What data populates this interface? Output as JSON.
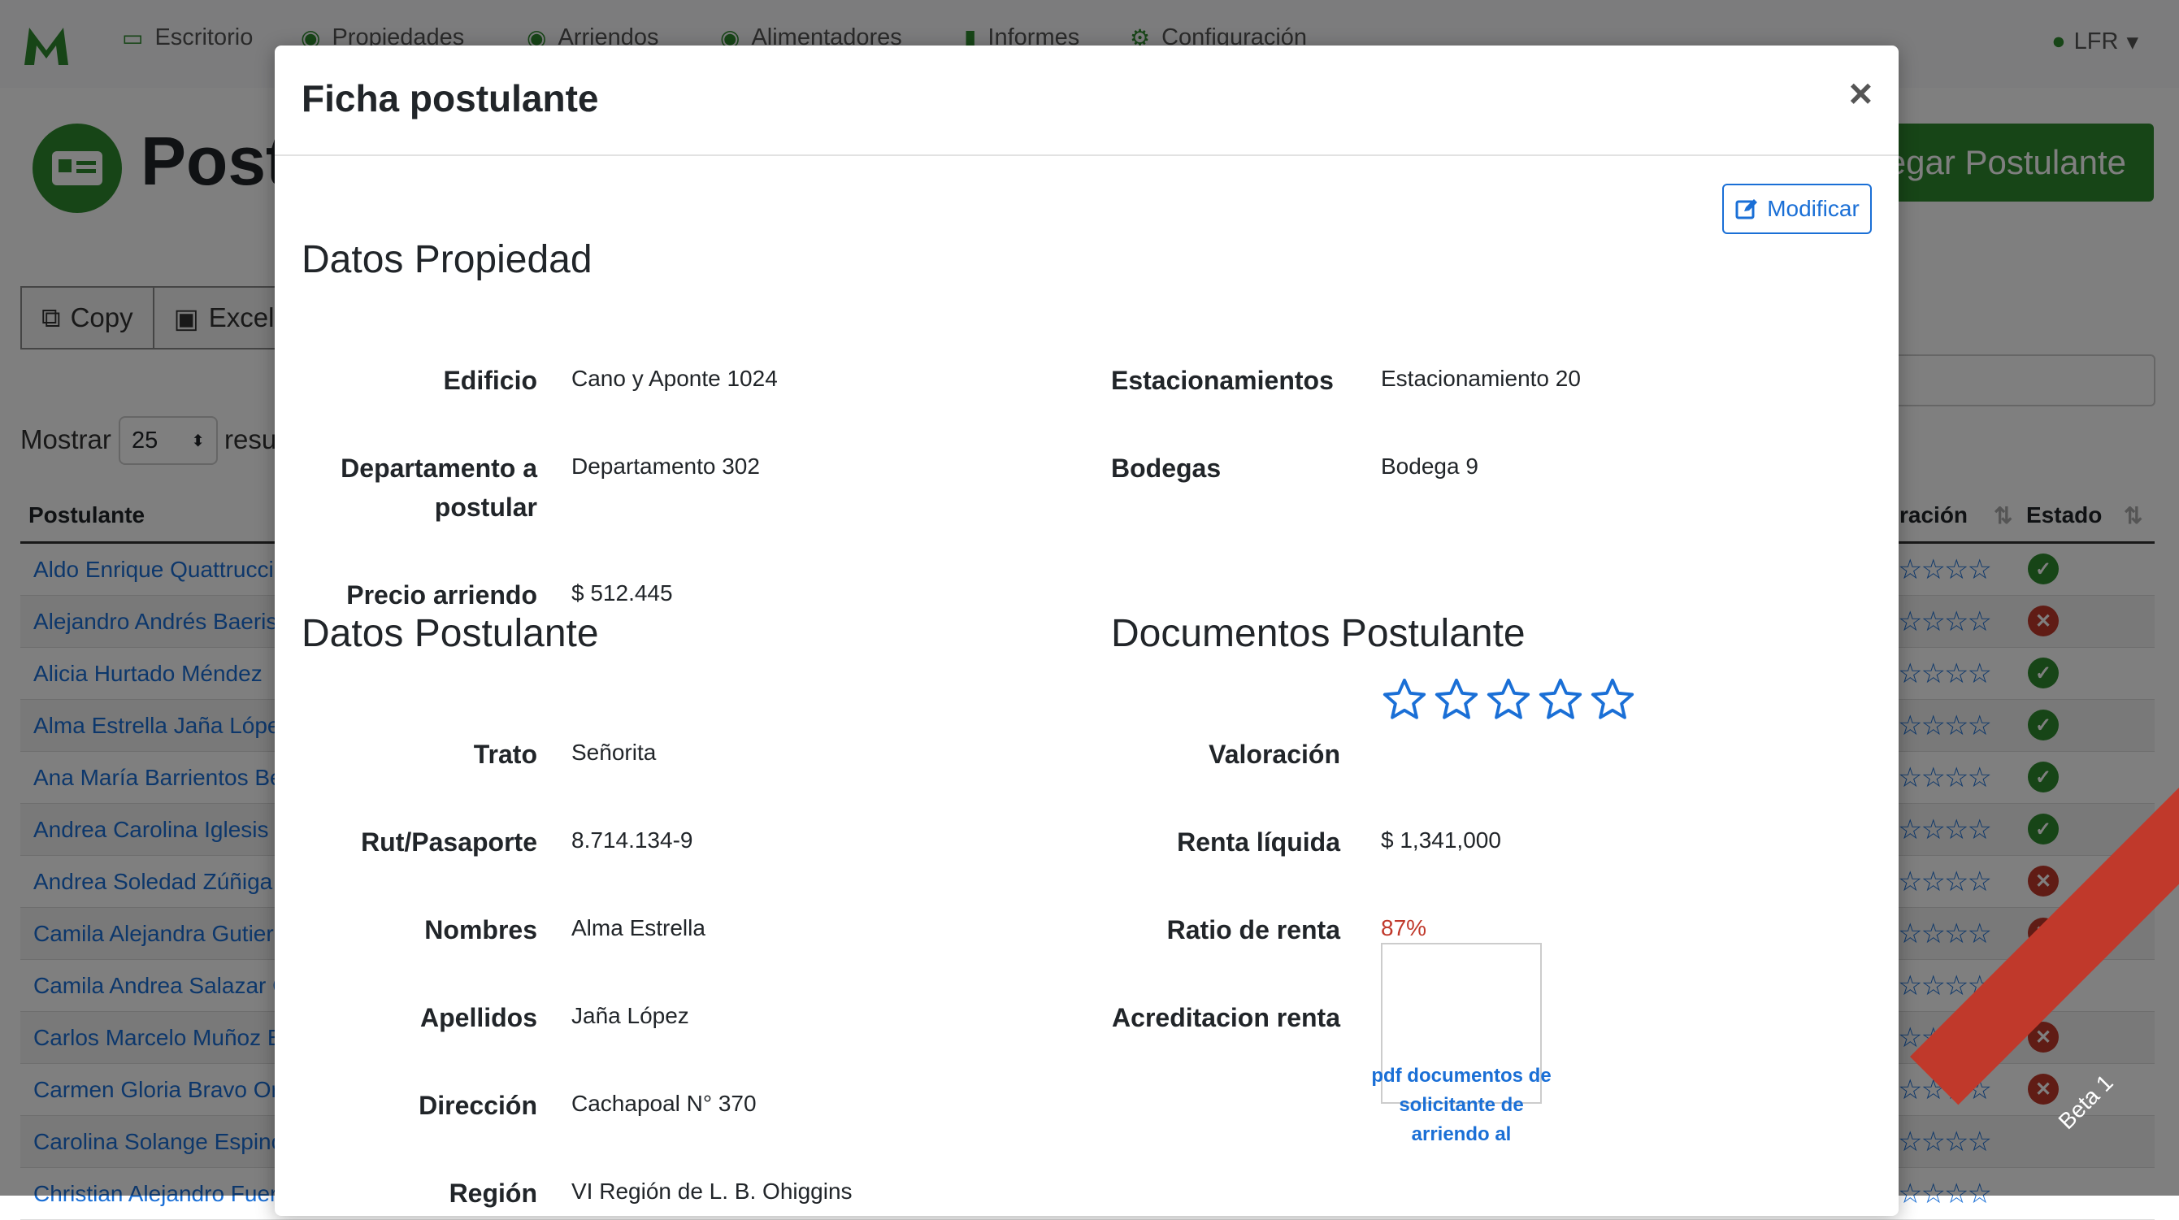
{
  "navbar": {
    "items": [
      {
        "label": "Escritorio",
        "icon": "monitor-icon"
      },
      {
        "label": "Propiedades",
        "icon": "database-icon"
      },
      {
        "label": "Arriendos",
        "icon": "database-icon"
      },
      {
        "label": "Alimentadores",
        "icon": "database-icon"
      },
      {
        "label": "Informes",
        "icon": "bar-chart-icon"
      },
      {
        "label": "Configuración",
        "icon": "gear-icon"
      }
    ],
    "user": "LFR"
  },
  "page": {
    "title": "Postu",
    "add_button": "regar Postulante",
    "buttons": [
      "Copy",
      "Excel"
    ],
    "length_label": "Mostrar",
    "length_value": "25",
    "length_after": "resu"
  },
  "table": {
    "headers": [
      "Postulante",
      "ración",
      "Estado"
    ],
    "rows": [
      {
        "name": "Aldo Enrique Quattrucci",
        "status": "ok"
      },
      {
        "name": "Alejandro Andrés Baeris",
        "status": "rejected"
      },
      {
        "name": "Alicia Hurtado Méndez",
        "status": "ok"
      },
      {
        "name": "Alma Estrella Jaña Lópe",
        "status": "ok"
      },
      {
        "name": "Ana María Barrientos Be",
        "status": "ok"
      },
      {
        "name": "Andrea Carolina Iglesis I",
        "status": "ok"
      },
      {
        "name": "Andrea Soledad Zúñiga",
        "status": "rejected"
      },
      {
        "name": "Camila Alejandra Gutierr",
        "status": "rejected"
      },
      {
        "name": "Camila Andrea Salazar C",
        "status": "rejected"
      },
      {
        "name": "Carlos Marcelo Muñoz E",
        "status": "rejected"
      },
      {
        "name": "Carmen Gloria Bravo Ort",
        "status": "rejected"
      },
      {
        "name": "Carolina Solange Espino",
        "status": "none"
      },
      {
        "name": "Christian Alejandro Fuer",
        "status": "none"
      }
    ]
  },
  "ribbon": "Beta 1",
  "modal": {
    "title": "Ficha postulante",
    "close": "×",
    "modify_label": "Modificar",
    "propiedad": {
      "title": "Datos Propiedad",
      "edificio_label": "Edificio",
      "edificio": "Cano y Aponte 1024",
      "depto_label": "Departamento a postular",
      "depto": "Departamento 302",
      "precio_label": "Precio arriendo",
      "precio": "$ 512.445",
      "estac_label": "Estacionamientos",
      "estac": "Estacionamiento 20",
      "bodegas_label": "Bodegas",
      "bodegas": "Bodega 9"
    },
    "postulante": {
      "title": "Datos Postulante",
      "trato_label": "Trato",
      "trato": "Señorita",
      "rut_label": "Rut/Pasaporte",
      "rut": "8.714.134-9",
      "nombres_label": "Nombres",
      "nombres": "Alma Estrella",
      "apellidos_label": "Apellidos",
      "apellidos": "Jaña López",
      "direccion_label": "Dirección",
      "direccion": "Cachapoal N° 370",
      "region_label": "Región",
      "region": "VI Región de L. B. Ohiggins"
    },
    "documentos": {
      "title": "Documentos Postulante",
      "valoracion_label": "Valoración",
      "valoracion_stars_filled": 0,
      "valoracion_stars_total": 5,
      "renta_label": "Renta líquida",
      "renta": "$ 1,341,000",
      "ratio_label": "Ratio de renta",
      "ratio": "87%",
      "acred_label": "Acreditacion renta",
      "pdf_text": "pdf documentos de solicitante de arriendo al"
    }
  }
}
